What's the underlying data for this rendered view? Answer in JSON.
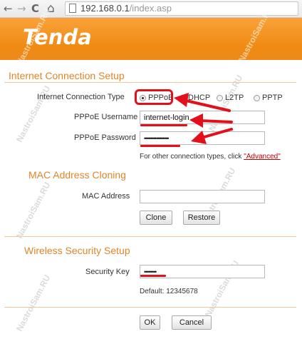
{
  "browser": {
    "url_host": "192.168.0.1",
    "url_path": "/index.asp",
    "back_glyph": "←",
    "forward_glyph": "→",
    "reload_glyph": "C",
    "home_glyph": "⌂"
  },
  "header": {
    "logo_text": "Tenda",
    "accent_color": "#f08a12"
  },
  "watermark": "NastroiSam.RU",
  "internet": {
    "section_title": "Internet Connection Setup",
    "type_label": "Internet Connection Type",
    "options": [
      {
        "label": "PPPoE",
        "checked": true
      },
      {
        "label": "DHCP",
        "checked": false
      },
      {
        "label": "L2TP",
        "checked": false
      },
      {
        "label": "PPTP",
        "checked": false
      }
    ],
    "username_label": "PPPoE Username",
    "username_value": "internet-login",
    "password_label": "PPPoE Password",
    "password_value": "••••••••••••••••",
    "note_text": "For other connection types, click",
    "note_link": "\"Advanced\""
  },
  "mac": {
    "section_title": "MAC Address Cloning",
    "address_label": "MAC Address",
    "address_value": "",
    "clone_label": "Clone",
    "restore_label": "Restore"
  },
  "wireless": {
    "section_title": "Wireless Security Setup",
    "key_label": "Security Key",
    "key_value": "••••••••",
    "default_text": "Default: 12345678"
  },
  "footer": {
    "ok_label": "OK",
    "cancel_label": "Cancel"
  },
  "annotation_color": "#e2101b"
}
